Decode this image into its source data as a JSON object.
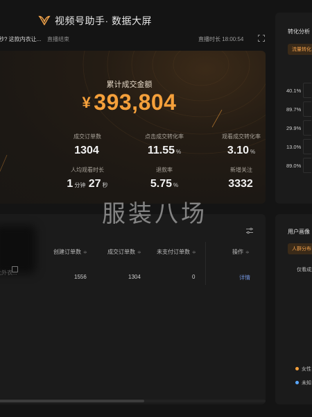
{
  "header": {
    "app_title": "视频号助手· 数据大屏",
    "live_title": "秒? 这款内衣让...",
    "live_status": "直播结束",
    "duration_label": "直播时长 18:00:54"
  },
  "kpi": {
    "total_label": "累计成交金额",
    "currency": "¥",
    "total_value": "393,804",
    "metrics": [
      {
        "label": "成交订单数",
        "value": "1304",
        "unit": ""
      },
      {
        "label": "点击成交转化率",
        "value": "11.55",
        "unit": "%"
      },
      {
        "label": "观看成交转化率",
        "value": "3.10",
        "unit": "%"
      },
      {
        "label": "人均观看时长",
        "value_min": "1",
        "unit_min": "分钟",
        "value_sec": "27",
        "unit_sec": "秒"
      },
      {
        "label": "退款率",
        "value": "5.75",
        "unit": "%"
      },
      {
        "label": "新增关注",
        "value": "3332",
        "unit": ""
      }
    ]
  },
  "watermark": "服装八场",
  "table": {
    "columns": [
      "创建订单数",
      "成交订单数",
      "未支付订单数",
      "操作"
    ],
    "sort_glyph": "≑",
    "row": {
      "name": "此外衣...",
      "created": "1556",
      "completed": "1304",
      "unpaid": "0",
      "action": "详情"
    }
  },
  "right_top": {
    "title": "转化分析",
    "tab": "流量转化",
    "percents": [
      "40.1%",
      "89.7%",
      "29.9%",
      "13.0%",
      "89.0%"
    ]
  },
  "right_bottom": {
    "title": "用户画像",
    "tab": "人群分布",
    "checkbox_label": "仅看成交",
    "legend": [
      {
        "label": "女性",
        "color": "#f5a03b"
      },
      {
        "label": "未知",
        "color": "#5aa8ff"
      }
    ]
  },
  "colors": {
    "accent": "#f5a03b",
    "link": "#6f8fd6",
    "background": "#141414",
    "card": "#1b1b1b"
  }
}
